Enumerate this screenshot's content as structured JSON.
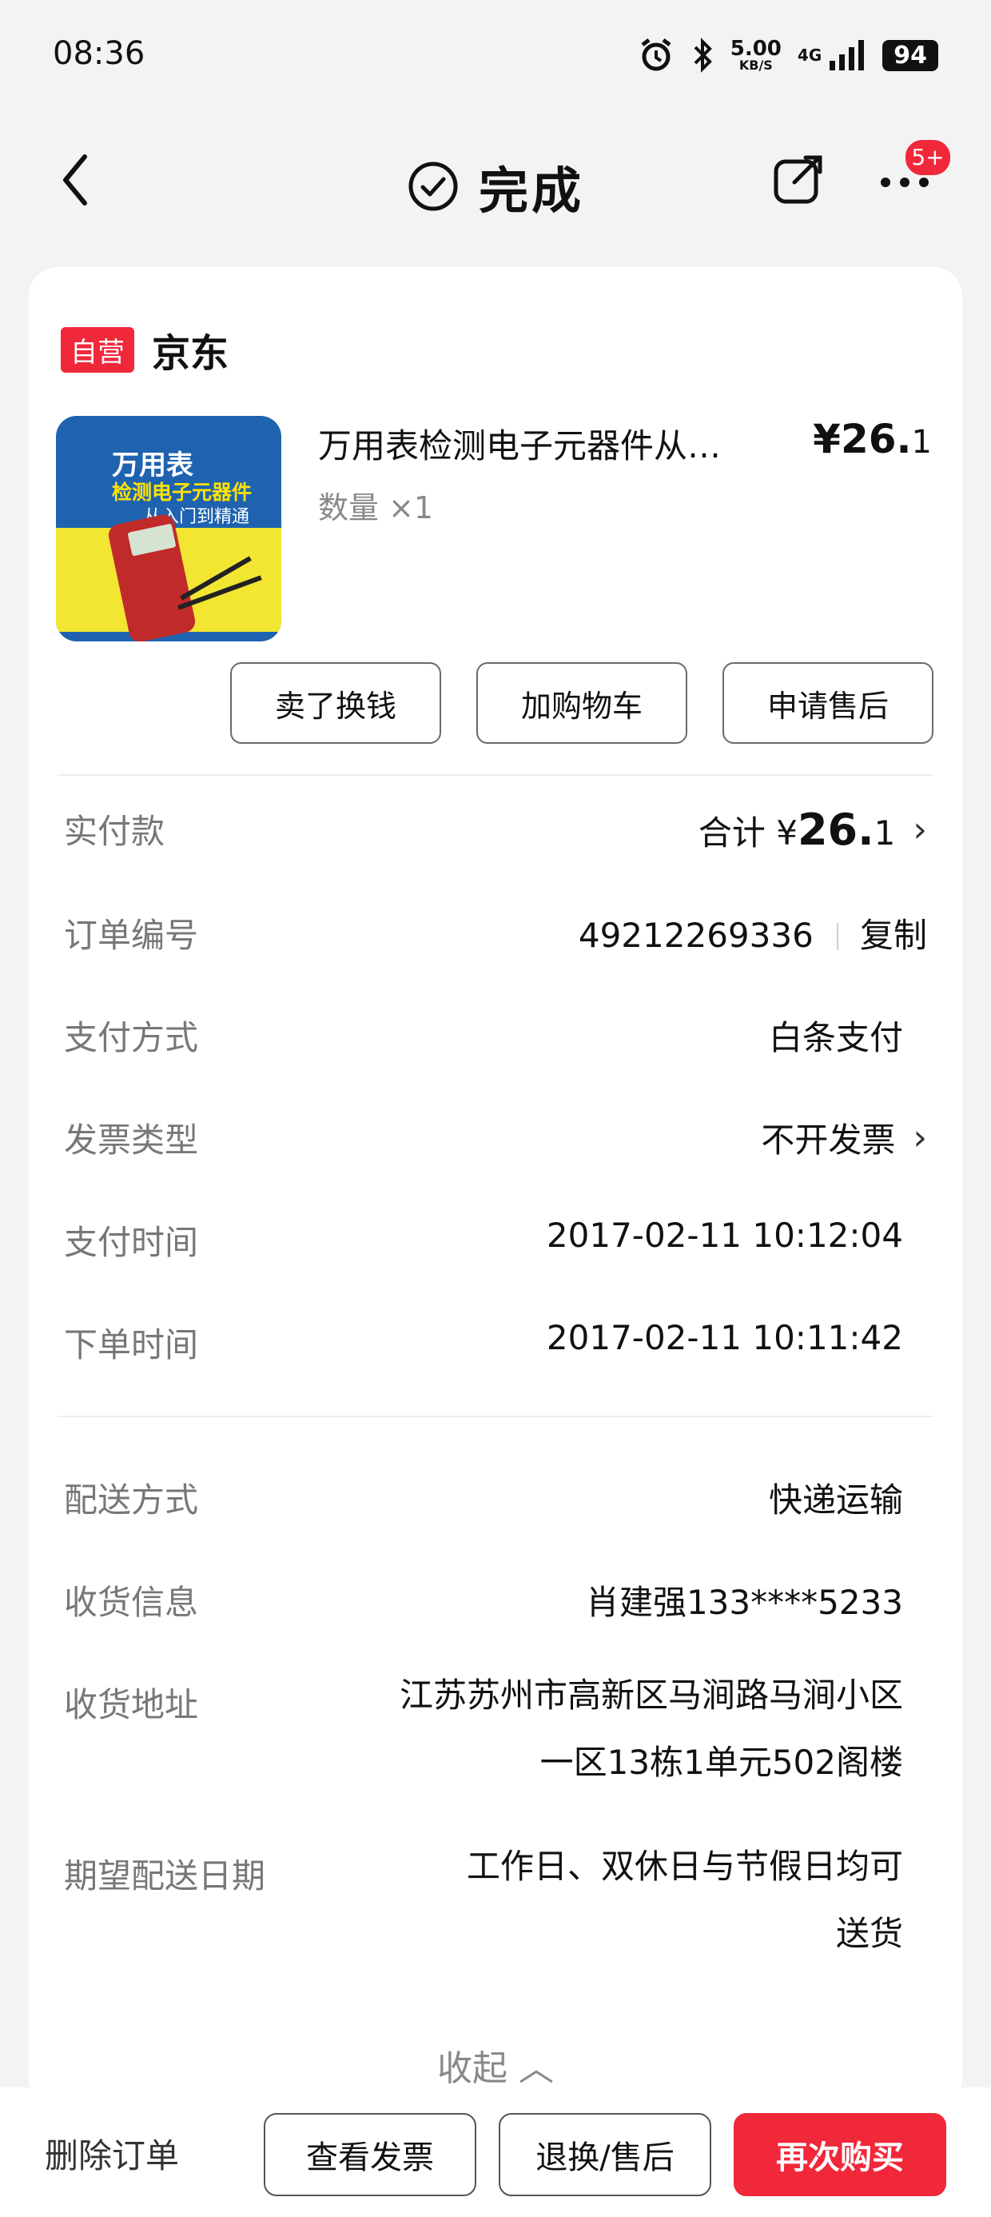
{
  "status_bar": {
    "time": "08:36",
    "speed_value": "5.00",
    "speed_unit": "KB/S",
    "network": "4G",
    "battery": "94"
  },
  "nav": {
    "title": "完成",
    "badge": "5+"
  },
  "shop": {
    "tag": "自营",
    "name": "京东"
  },
  "product": {
    "cover_title1": "万用表",
    "cover_title2": "检测电子元器件",
    "cover_title3": "从入门到精通",
    "title": "万用表检测电子元器件从…",
    "price_symbol": "¥",
    "price_int": "26.",
    "price_dec": "1",
    "quantity": "数量 ×1"
  },
  "actions": {
    "sell": "卖了换钱",
    "add_cart": "加购物车",
    "after_sale": "申请售后"
  },
  "order_info": [
    {
      "label": "实付款",
      "prefix": "合计 ¥",
      "value_big": "26.",
      "value_small": "1"
    },
    {
      "label": "订单编号",
      "value": "49212269336",
      "copy": "复制"
    },
    {
      "label": "支付方式",
      "value": "白条支付"
    },
    {
      "label": "发票类型",
      "value": "不开发票"
    },
    {
      "label": "支付时间",
      "value": "2017-02-11 10:12:04"
    },
    {
      "label": "下单时间",
      "value": "2017-02-11 10:11:42"
    }
  ],
  "delivery_info": [
    {
      "label": "配送方式",
      "value": "快递运输"
    },
    {
      "label": "收货信息",
      "value": "肖建强133****5233"
    },
    {
      "label": "收货地址",
      "line1": "江苏苏州市高新区马涧路马涧小区",
      "line2": "一区13栋1单元502阁楼"
    },
    {
      "label": "期望配送日期",
      "line1": "工作日、双休日与节假日均可",
      "line2": "送货"
    }
  ],
  "collapse": "收起",
  "bottom_bar": {
    "delete": "删除订单",
    "view_invoice": "查看发票",
    "return": "退换/售后",
    "buy_again": "再次购买"
  },
  "colors": {
    "accent_red": "#f0283a",
    "background": "#f3f3f3"
  }
}
